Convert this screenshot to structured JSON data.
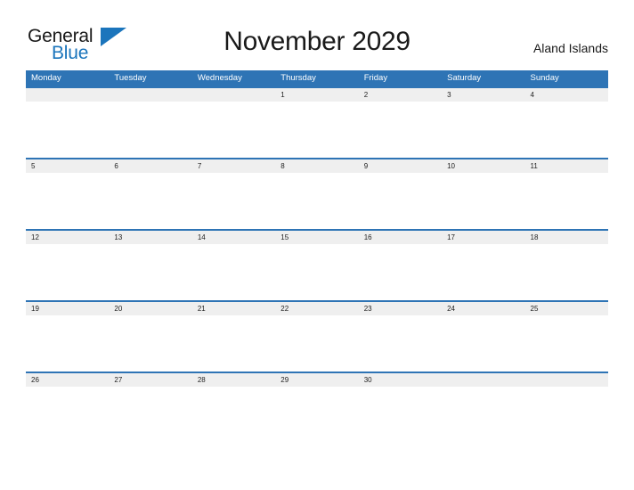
{
  "brand": {
    "name_part1": "General",
    "name_part2": "Blue",
    "flag_icon": "triangle-flag-icon",
    "accent_color": "#1b75bc"
  },
  "header": {
    "title": "November 2029",
    "location": "Aland Islands"
  },
  "theme": {
    "header_blue": "#2e74b5",
    "band_gray": "#efefef",
    "text_dark": "#1a1a1a",
    "background": "#ffffff"
  },
  "calendar": {
    "month": "November",
    "year": "2029",
    "weekday_headers": [
      "Monday",
      "Tuesday",
      "Wednesday",
      "Thursday",
      "Friday",
      "Saturday",
      "Sunday"
    ],
    "weeks": [
      [
        "",
        "",
        "",
        "1",
        "2",
        "3",
        "4"
      ],
      [
        "5",
        "6",
        "7",
        "8",
        "9",
        "10",
        "11"
      ],
      [
        "12",
        "13",
        "14",
        "15",
        "16",
        "17",
        "18"
      ],
      [
        "19",
        "20",
        "21",
        "22",
        "23",
        "24",
        "25"
      ],
      [
        "26",
        "27",
        "28",
        "29",
        "30",
        "",
        ""
      ]
    ]
  }
}
